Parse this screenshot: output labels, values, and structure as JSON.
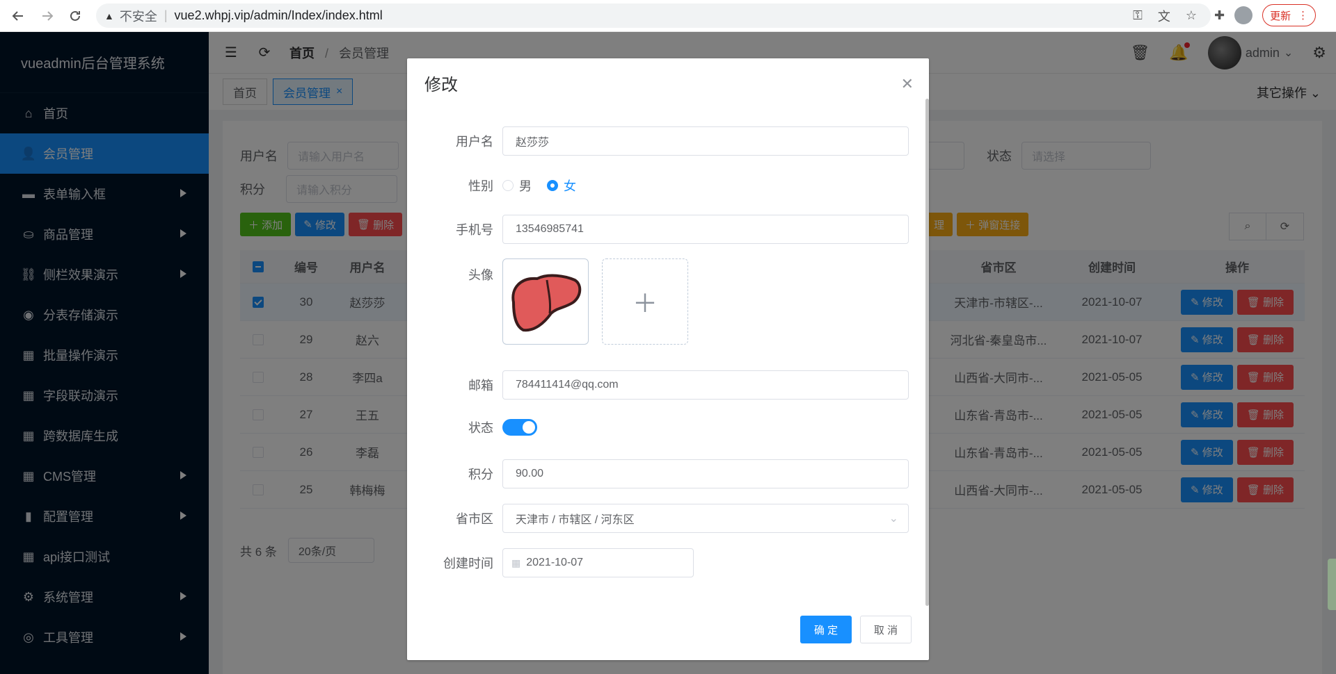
{
  "browser": {
    "insecure_label": "不安全",
    "url": "vue2.whpj.vip/admin/Index/index.html",
    "update_label": "更新"
  },
  "sidebar": {
    "logo": "vueadmin后台管理系统",
    "items": [
      {
        "label": "首页",
        "icon": "home-icon",
        "submenu": false
      },
      {
        "label": "会员管理",
        "icon": "user-icon",
        "submenu": false
      },
      {
        "label": "表单输入框",
        "icon": "briefcase-icon",
        "submenu": true
      },
      {
        "label": "商品管理",
        "icon": "bag-icon",
        "submenu": true
      },
      {
        "label": "侧栏效果演示",
        "icon": "link-icon",
        "submenu": true
      },
      {
        "label": "分表存储演示",
        "icon": "target-icon",
        "submenu": false
      },
      {
        "label": "批量操作演示",
        "icon": "grid-icon",
        "submenu": false
      },
      {
        "label": "字段联动演示",
        "icon": "grid-icon",
        "submenu": false
      },
      {
        "label": "跨数据库生成",
        "icon": "grid-icon",
        "submenu": false
      },
      {
        "label": "CMS管理",
        "icon": "grid-icon",
        "submenu": true
      },
      {
        "label": "配置管理",
        "icon": "bar-chart-icon",
        "submenu": true
      },
      {
        "label": "api接口测试",
        "icon": "grid-icon",
        "submenu": false
      },
      {
        "label": "系统管理",
        "icon": "gear-icon",
        "submenu": true
      },
      {
        "label": "工具管理",
        "icon": "lifebuoy-icon",
        "submenu": true
      }
    ]
  },
  "header": {
    "breadcrumb_home": "首页",
    "breadcrumb_current": "会员管理",
    "user": "admin"
  },
  "tabs": {
    "items": [
      "首页",
      "会员管理"
    ],
    "other_ops": "其它操作"
  },
  "search": {
    "username_label": "用户名",
    "username_placeholder": "请输入用户名",
    "score_label": "积分",
    "score_placeholder": "请输入积分",
    "status_label": "状态",
    "status_placeholder": "请选择"
  },
  "toolbar": {
    "add": "添加",
    "edit": "修改",
    "delete": "删除",
    "partial": "理",
    "popup": "弹窗连接"
  },
  "table": {
    "headers": {
      "id": "编号",
      "username": "用户名",
      "region": "省市区",
      "created": "创建时间",
      "ops": "操作"
    },
    "rows": [
      {
        "id": "30",
        "username": "赵莎莎",
        "region": "天津市-市辖区-...",
        "created": "2021-10-07",
        "selected": true
      },
      {
        "id": "29",
        "username": "赵六",
        "region": "河北省-秦皇岛市...",
        "created": "2021-10-07",
        "selected": false
      },
      {
        "id": "28",
        "username": "李四a",
        "region": "山西省-大同市-...",
        "created": "2021-05-05",
        "selected": false
      },
      {
        "id": "27",
        "username": "王五",
        "region": "山东省-青岛市-...",
        "created": "2021-05-05",
        "selected": false
      },
      {
        "id": "26",
        "username": "李磊",
        "region": "山东省-青岛市-...",
        "created": "2021-05-05",
        "selected": false
      },
      {
        "id": "25",
        "username": "韩梅梅",
        "region": "山西省-大同市-...",
        "created": "2021-05-05",
        "selected": false
      }
    ],
    "edit_label": "修改",
    "delete_label": "删除"
  },
  "pager": {
    "total": "共 6 条",
    "page_size": "20条/页"
  },
  "dialog": {
    "title": "修改",
    "fields": {
      "username_label": "用户名",
      "username_value": "赵莎莎",
      "gender_label": "性别",
      "gender_male": "男",
      "gender_female": "女",
      "gender_selected": "女",
      "phone_label": "手机号",
      "phone_value": "13546985741",
      "avatar_label": "头像",
      "email_label": "邮箱",
      "email_value": "784411414@qq.com",
      "status_label": "状态",
      "status_on": true,
      "score_label": "积分",
      "score_value": "90.00",
      "region_label": "省市区",
      "region_value": "天津市 / 市辖区 / 河东区",
      "created_label": "创建时间",
      "created_value": "2021-10-07"
    },
    "confirm": "确 定",
    "cancel": "取 消"
  },
  "colors": {
    "sidebar_bg": "#001529",
    "primary": "#1890ff",
    "danger": "#ff4d4f",
    "success": "#52c41a",
    "warning": "#faad14"
  }
}
